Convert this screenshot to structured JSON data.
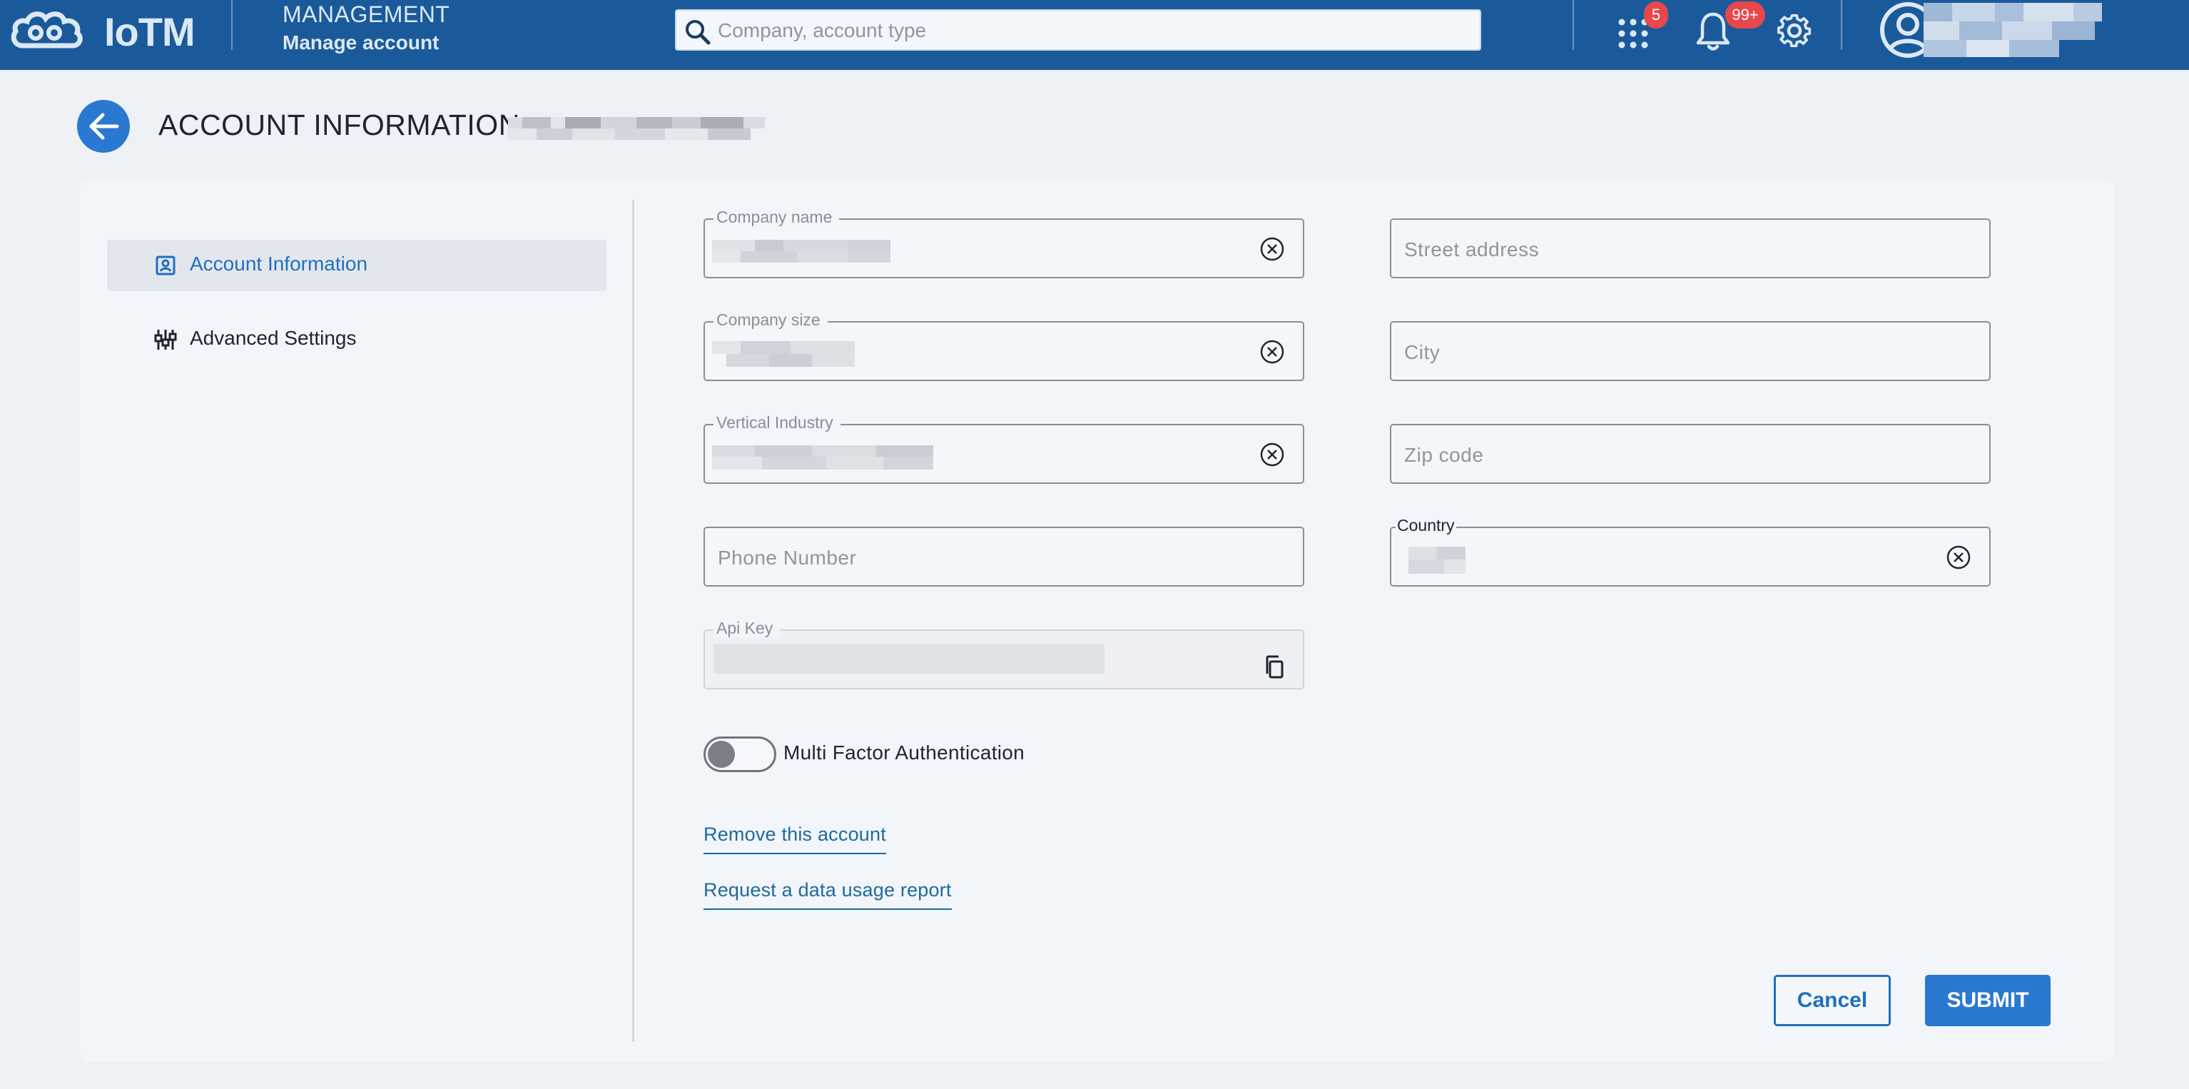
{
  "header": {
    "logo_text": "IoTM",
    "section_title": "MANAGEMENT",
    "section_subtitle": "Manage account",
    "search_placeholder": "Company, account type",
    "apps_badge": "5",
    "notifications_badge": "99+",
    "accent_color": "#1b5a9a"
  },
  "page": {
    "title": "ACCOUNT INFORMATION:"
  },
  "sidebar": {
    "items": [
      {
        "label": "Account Information",
        "icon": "account-card-icon",
        "active": true
      },
      {
        "label": "Advanced Settings",
        "icon": "sliders-icon",
        "active": false
      }
    ]
  },
  "form": {
    "company_name_label": "Company name",
    "company_size_label": "Company size",
    "vertical_industry_label": "Vertical Industry",
    "phone_placeholder": "Phone Number",
    "api_key_label": "Api Key",
    "street_placeholder": "Street address",
    "city_placeholder": "City",
    "zip_placeholder": "Zip code",
    "country_label": "Country",
    "mfa_label": "Multi Factor Authentication",
    "mfa_enabled": false
  },
  "links": {
    "remove_account": "Remove this account",
    "data_usage_report": "Request a data usage report"
  },
  "actions": {
    "cancel": "Cancel",
    "submit": "SUBMIT"
  }
}
